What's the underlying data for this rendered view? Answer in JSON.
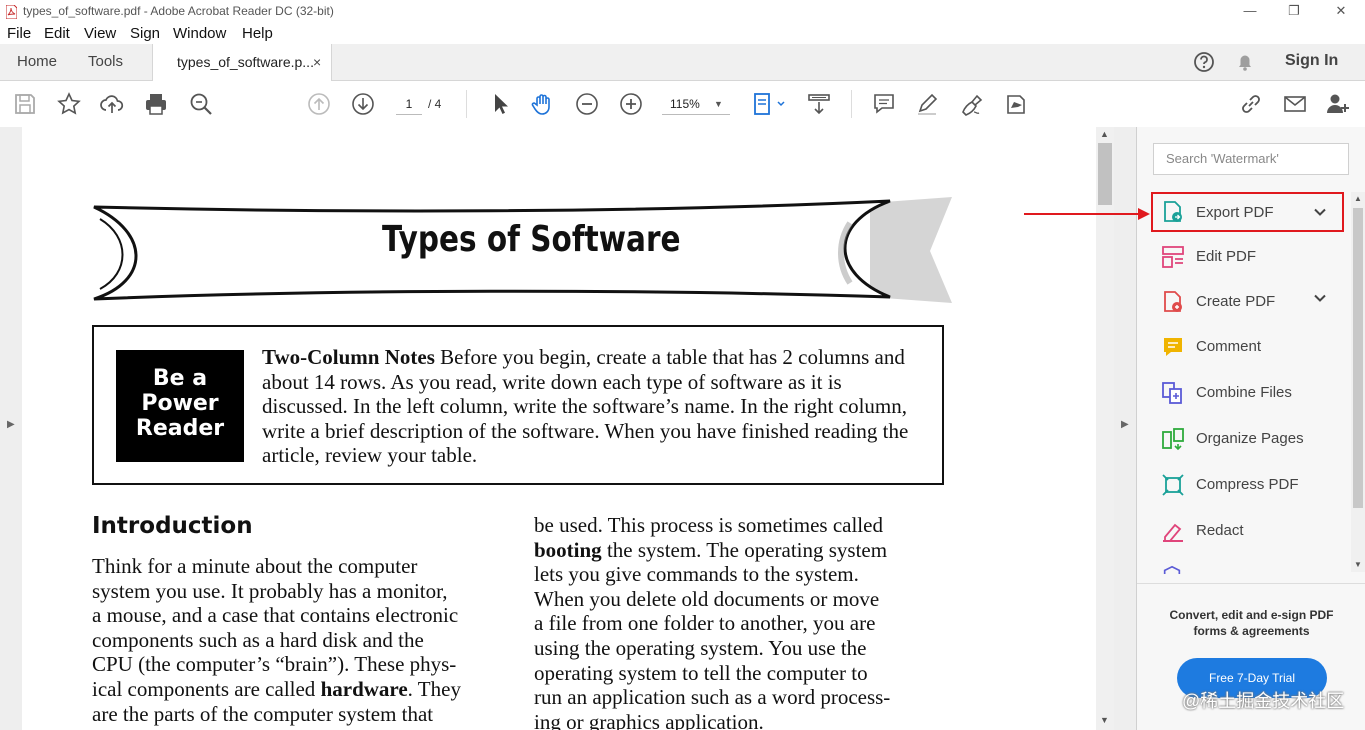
{
  "window": {
    "title": "types_of_software.pdf - Adobe Acrobat Reader DC (32-bit)",
    "minimize": "—",
    "restore": "❐",
    "close": "✕"
  },
  "menu": [
    "File",
    "Edit",
    "View",
    "Sign",
    "Window",
    "Help"
  ],
  "tabs": {
    "home": "Home",
    "tools": "Tools",
    "document": "types_of_software.p...",
    "close_glyph": "×",
    "sign_in": "Sign In"
  },
  "toolbar": {
    "page_current": "1",
    "page_total": "/ 4",
    "zoom": "115%"
  },
  "document": {
    "banner_title": "Types of Software",
    "power_reader": [
      "Be a",
      "Power",
      "Reader"
    ],
    "notes_heading": "Two-Column Notes",
    "notes_body": " Before you begin, create a table that has 2 columns and about 14 rows. As you read, write down each type of software as it is discussed. In the left column, write the software’s name. In the right column, write a brief description of the software. When you have finished reading the article, review your table.",
    "intro_heading": "Introduction",
    "left_col": [
      "Think for a minute about the computer",
      "system you use. It probably has a monitor,",
      "a mouse, and a case that contains electronic",
      "components such as a hard disk and the",
      "CPU (the computer’s “brain”). These phys-",
      "ical components are called ",
      "are the parts of the computer system that"
    ],
    "left_bold_word": "hardware",
    "left_after_bold": ". They",
    "right_col": [
      "be used. This process is sometimes called",
      " the system. The operating system",
      "lets you give commands to the system.",
      "When you delete old documents or move",
      "a file from one folder to another, you are",
      "using the operating system. You use the",
      "operating system to tell the computer to",
      "run an application such as a word process-",
      "ing or graphics application."
    ],
    "right_bold_word": "booting"
  },
  "right_pane": {
    "search_placeholder": "Search 'Watermark'",
    "tools": [
      {
        "label": "Export PDF",
        "icon": "export-pdf-icon",
        "color": "#1aa198"
      },
      {
        "label": "Edit PDF",
        "icon": "edit-pdf-icon",
        "color": "#e0457b"
      },
      {
        "label": "Create PDF",
        "icon": "create-pdf-icon",
        "color": "#e04b4b"
      },
      {
        "label": "Comment",
        "icon": "comment-icon",
        "color": "#f0b400"
      },
      {
        "label": "Combine Files",
        "icon": "combine-files-icon",
        "color": "#5b5bd6"
      },
      {
        "label": "Organize Pages",
        "icon": "organize-pages-icon",
        "color": "#2eaa3c"
      },
      {
        "label": "Compress PDF",
        "icon": "compress-pdf-icon",
        "color": "#1aa198"
      },
      {
        "label": "Redact",
        "icon": "redact-icon",
        "color": "#e0457b"
      }
    ],
    "promo": [
      "Convert, edit and e-sign PDF",
      "forms & agreements"
    ],
    "trial_button": "Free 7-Day Trial"
  },
  "watermark": "@稀土掘金技术社区"
}
